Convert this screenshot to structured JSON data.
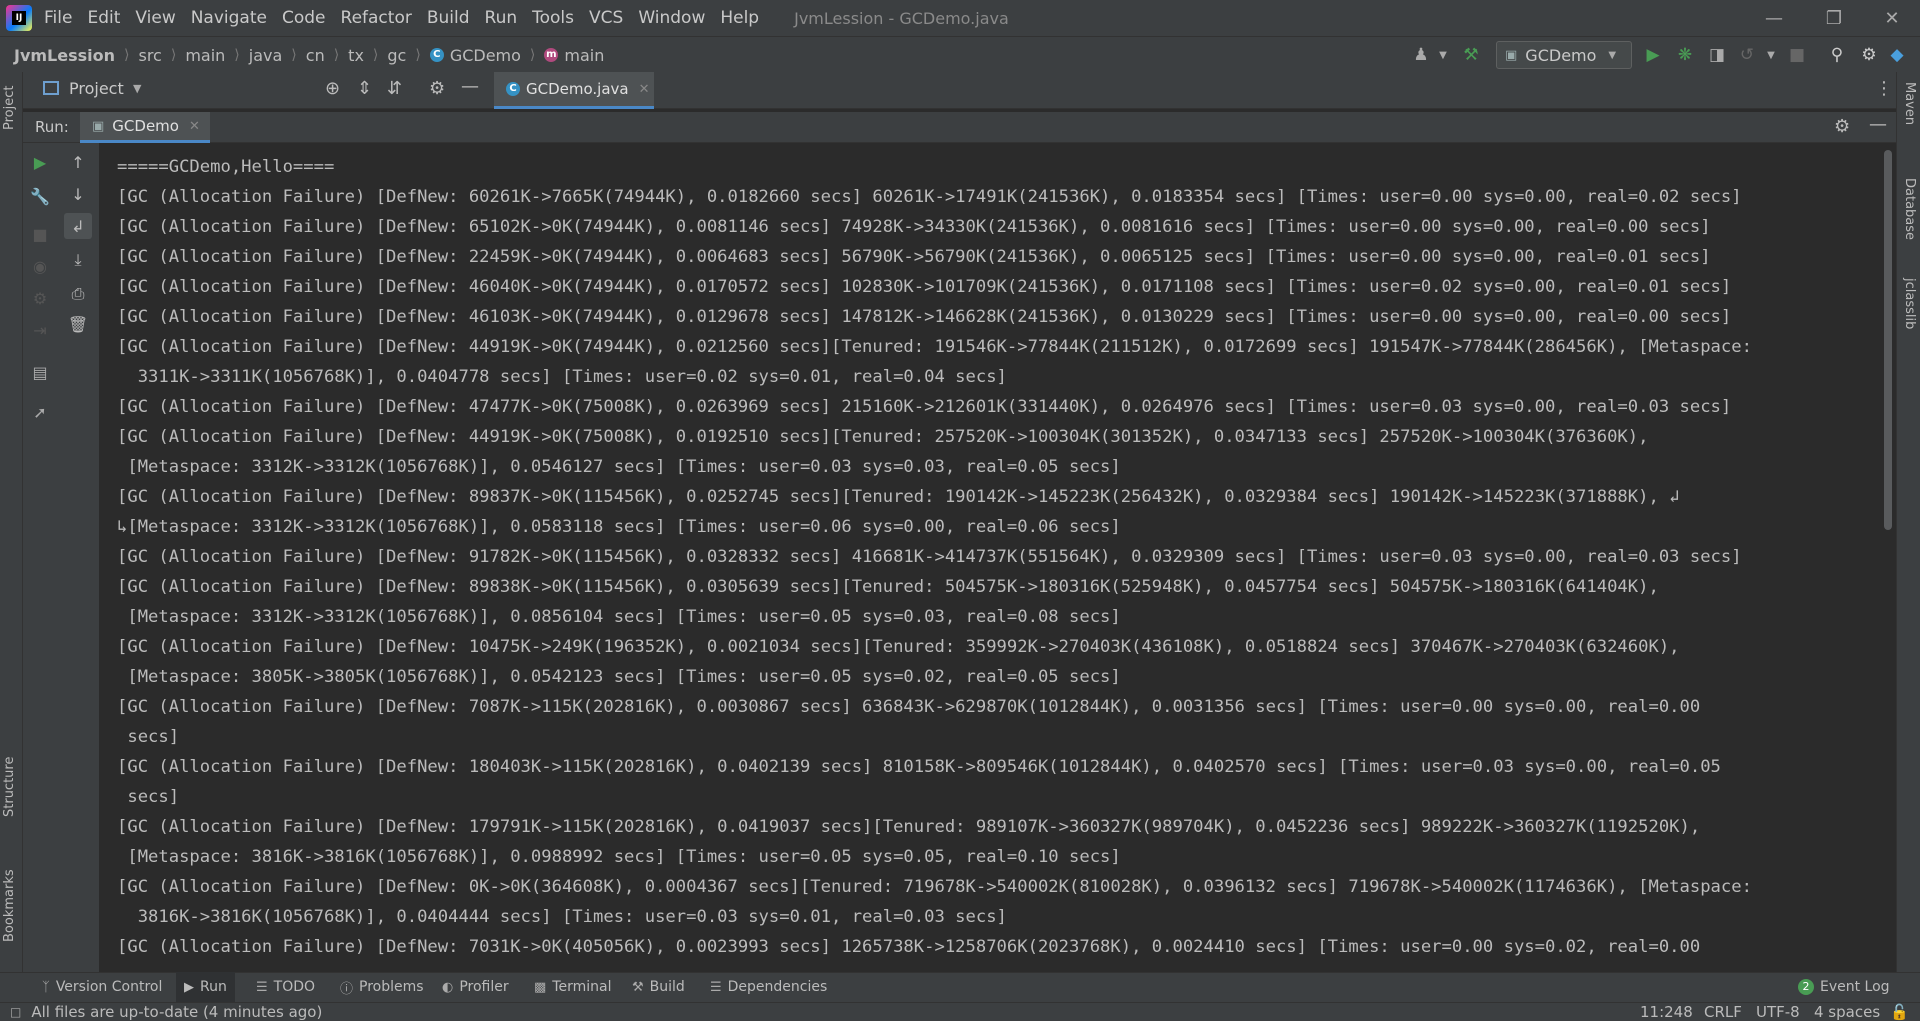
{
  "menu": {
    "items": [
      "File",
      "Edit",
      "View",
      "Navigate",
      "Code",
      "Refactor",
      "Build",
      "Run",
      "Tools",
      "VCS",
      "Window",
      "Help"
    ],
    "window_title": "JvmLession - GCDemo.java"
  },
  "breadcrumb": {
    "project": "JvmLession",
    "items": [
      "src",
      "main",
      "java",
      "cn",
      "tx",
      "gc"
    ],
    "class_name": "GCDemo",
    "method_name": "main"
  },
  "toolbar": {
    "run_config": "GCDemo"
  },
  "project_panel": {
    "label": "Project",
    "stripe_label": "Project"
  },
  "editor": {
    "tab_label": "GCDemo.java"
  },
  "run_panel": {
    "label": "Run:",
    "tab_label": "GCDemo"
  },
  "right_stripe": {
    "items": [
      "Maven",
      "Database",
      "jclasslib"
    ]
  },
  "left_stripe_bottom": {
    "items": [
      "Structure",
      "Bookmarks"
    ]
  },
  "console": {
    "lines": [
      "=====GCDemo,Hello====",
      "[GC (Allocation Failure) [DefNew: 60261K->7665K(74944K), 0.0182660 secs] 60261K->17491K(241536K), 0.0183354 secs] [Times: user=0.00 sys=0.00, real=0.02 secs]",
      "[GC (Allocation Failure) [DefNew: 65102K->0K(74944K), 0.0081146 secs] 74928K->34330K(241536K), 0.0081616 secs] [Times: user=0.00 sys=0.00, real=0.00 secs]",
      "[GC (Allocation Failure) [DefNew: 22459K->0K(74944K), 0.0064683 secs] 56790K->56790K(241536K), 0.0065125 secs] [Times: user=0.00 sys=0.00, real=0.01 secs]",
      "[GC (Allocation Failure) [DefNew: 46040K->0K(74944K), 0.0170572 secs] 102830K->101709K(241536K), 0.0171108 secs] [Times: user=0.02 sys=0.00, real=0.01 secs]",
      "[GC (Allocation Failure) [DefNew: 46103K->0K(74944K), 0.0129678 secs] 147812K->146628K(241536K), 0.0130229 secs] [Times: user=0.00 sys=0.00, real=0.00 secs]",
      "[GC (Allocation Failure) [DefNew: 44919K->0K(74944K), 0.0212560 secs][Tenured: 191546K->77844K(211512K), 0.0172699 secs] 191547K->77844K(286456K), [Metaspace:",
      "  3311K->3311K(1056768K)], 0.0404778 secs] [Times: user=0.02 sys=0.01, real=0.04 secs]",
      "[GC (Allocation Failure) [DefNew: 47477K->0K(75008K), 0.0263969 secs] 215160K->212601K(331440K), 0.0264976 secs] [Times: user=0.03 sys=0.00, real=0.03 secs]",
      "[GC (Allocation Failure) [DefNew: 44919K->0K(75008K), 0.0192510 secs][Tenured: 257520K->100304K(301352K), 0.0347133 secs] 257520K->100304K(376360K),",
      " [Metaspace: 3312K->3312K(1056768K)], 0.0546127 secs] [Times: user=0.03 sys=0.03, real=0.05 secs]",
      "[GC (Allocation Failure) [DefNew: 89837K->0K(115456K), 0.0252745 secs][Tenured: 190142K->145223K(256432K), 0.0329384 secs] 190142K->145223K(371888K), ↲",
      "↳[Metaspace: 3312K->3312K(1056768K)], 0.0583118 secs] [Times: user=0.06 sys=0.00, real=0.06 secs]",
      "[GC (Allocation Failure) [DefNew: 91782K->0K(115456K), 0.0328332 secs] 416681K->414737K(551564K), 0.0329309 secs] [Times: user=0.03 sys=0.00, real=0.03 secs]",
      "[GC (Allocation Failure) [DefNew: 89838K->0K(115456K), 0.0305639 secs][Tenured: 504575K->180316K(525948K), 0.0457754 secs] 504575K->180316K(641404K),",
      " [Metaspace: 3312K->3312K(1056768K)], 0.0856104 secs] [Times: user=0.05 sys=0.03, real=0.08 secs]",
      "[GC (Allocation Failure) [DefNew: 10475K->249K(196352K), 0.0021034 secs][Tenured: 359992K->270403K(436108K), 0.0518824 secs] 370467K->270403K(632460K),",
      " [Metaspace: 3805K->3805K(1056768K)], 0.0542123 secs] [Times: user=0.05 sys=0.02, real=0.05 secs]",
      "[GC (Allocation Failure) [DefNew: 7087K->115K(202816K), 0.0030867 secs] 636843K->629870K(1012844K), 0.0031356 secs] [Times: user=0.00 sys=0.00, real=0.00",
      " secs]",
      "[GC (Allocation Failure) [DefNew: 180403K->115K(202816K), 0.0402139 secs] 810158K->809546K(1012844K), 0.0402570 secs] [Times: user=0.03 sys=0.00, real=0.05",
      " secs]",
      "[GC (Allocation Failure) [DefNew: 179791K->115K(202816K), 0.0419037 secs][Tenured: 989107K->360327K(989704K), 0.0452236 secs] 989222K->360327K(1192520K),",
      " [Metaspace: 3816K->3816K(1056768K)], 0.0988992 secs] [Times: user=0.05 sys=0.05, real=0.10 secs]",
      "[GC (Allocation Failure) [DefNew: 0K->0K(364608K), 0.0004367 secs][Tenured: 719678K->540002K(810028K), 0.0396132 secs] 719678K->540002K(1174636K), [Metaspace:",
      "  3816K->3816K(1056768K)], 0.0404444 secs] [Times: user=0.03 sys=0.01, real=0.03 secs]",
      "[GC (Allocation Failure) [DefNew: 7031K->0K(405056K), 0.0023993 secs] 1265738K->1258706K(2023768K), 0.0024410 secs] [Times: user=0.00 sys=0.02, real=0.00"
    ]
  },
  "bottom_tabs": {
    "version_control": "Version Control",
    "run": "Run",
    "todo": "TODO",
    "problems": "Problems",
    "profiler": "Profiler",
    "terminal": "Terminal",
    "build": "Build",
    "dependencies": "Dependencies",
    "event_log": "Event Log",
    "event_log_count": "2"
  },
  "status": {
    "message": "All files are up-to-date (4 minutes ago)",
    "position": "11:248",
    "line_separator": "CRLF",
    "encoding": "UTF-8",
    "indent": "4 spaces"
  },
  "colors": {
    "background": "#2b2b2b",
    "panel": "#3c3f41",
    "text": "#bbbbbb",
    "run_green": "#499c54",
    "accent_blue": "#4a88c7"
  }
}
